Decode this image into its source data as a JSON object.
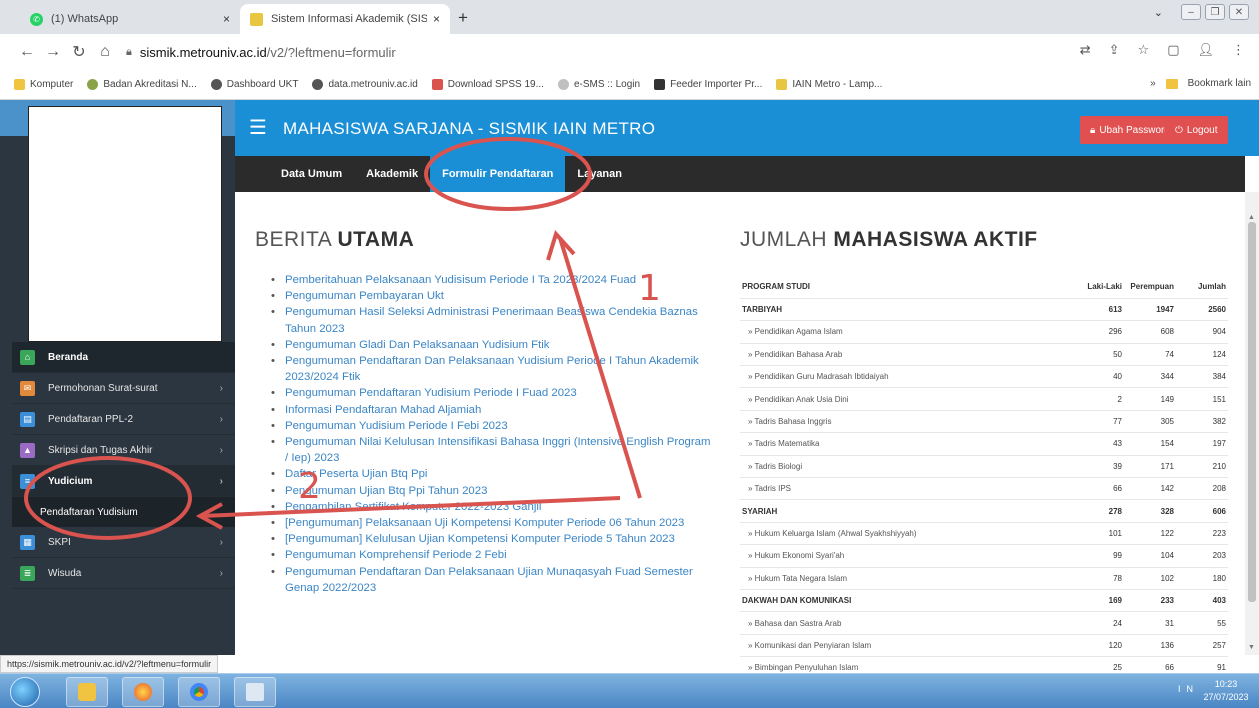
{
  "browser": {
    "tabs": [
      {
        "title": "(1) WhatsApp",
        "close": "×"
      },
      {
        "title": "Sistem Informasi Akademik (SIS",
        "close": "×"
      }
    ],
    "new_tab": "+",
    "url_host": "sismik.metrouniv.ac.id",
    "url_path": "/v2/?leftmenu=formulir",
    "bookmarks": [
      {
        "label": "Komputer",
        "color": "#f0c341"
      },
      {
        "label": "Badan Akreditasi N...",
        "color": "#8aa34a"
      },
      {
        "label": "Dashboard UKT",
        "color": "#555555"
      },
      {
        "label": "data.metrouniv.ac.id",
        "color": "#555555"
      },
      {
        "label": "Download SPSS 19...",
        "color": "#d9534f"
      },
      {
        "label": "e-SMS :: Login",
        "color": "#c0c0c0"
      },
      {
        "label": "Feeder Importer Pr...",
        "color": "#333333"
      },
      {
        "label": "IAIN Metro - Lamp...",
        "color": "#e8c642"
      }
    ],
    "bookmarks_more": "»",
    "bookmark_right": "Bookmark lain",
    "status_url": "https://sismik.metrouniv.ac.id/v2/?leftmenu=formulir"
  },
  "topbar": {
    "title": "MAHASISWA SARJANA - SISMIK IAIN METRO",
    "change_password": "Ubah Password",
    "logout": "Logout"
  },
  "nav": [
    "Data Umum",
    "Akademik",
    "Formulir Pendaftaran",
    "Layanan"
  ],
  "sidebar": {
    "items": [
      {
        "label": "Beranda",
        "color": "#3aa65a",
        "arrow": ""
      },
      {
        "label": "Permohonan Surat-surat",
        "color": "#e2893c",
        "arrow": "›"
      },
      {
        "label": "Pendaftaran PPL-2",
        "color": "#3b8ed8",
        "arrow": "›"
      },
      {
        "label": "Skripsi dan Tugas Akhir",
        "color": "#9a6bc4",
        "arrow": "›"
      },
      {
        "label": "Yudicium",
        "color": "#3b8ed8",
        "arrow": "›"
      }
    ],
    "sub_item": "Pendaftaran Yudisium",
    "items_after": [
      {
        "label": "SKPI",
        "color": "#3b8ed8",
        "arrow": "›"
      },
      {
        "label": "Wisuda",
        "color": "#3aa65a",
        "arrow": "›"
      }
    ]
  },
  "berita": {
    "title_light": "BERITA",
    "title_bold": "UTAMA",
    "items": [
      "Pemberitahuan Pelaksanaan Yudisisum Periode I Ta 2023/2024 Fuad",
      "Pengumuman Pembayaran Ukt",
      "Pengumuman Hasil Seleksi Administrasi Penerimaan Beasiswa Cendekia Baznas Tahun 2023",
      "Pengumuman Gladi Dan Pelaksanaan Yudisium Ftik",
      "Pengumuman Pendaftaran Dan Pelaksanaan Yudisium Periode I Tahun Akademik 2023/2024 Ftik",
      "Pengumuman Pendaftaran Yudisium Periode I Fuad 2023",
      "Informasi Pendaftaran Mahad Aljamiah",
      "Pengumuman Yudisium Periode I Febi 2023",
      "Pengumuman Nilai Kelulusan Intensifikasi Bahasa Inggri (Intensive English Program / Iep) 2023",
      "Daftar Peserta Ujian Btq Ppi",
      "Pengumuman Ujian Btq Ppi Tahun 2023",
      "Pengambilan Sertifikat Komputer 2022-2023 Ganjil",
      "[Pengumuman] Pelaksanaan Uji Kompetensi Komputer Periode 06 Tahun 2023",
      "[Pengumuman] Kelulusan Ujian Kompetensi Komputer Periode 5 Tahun 2023",
      "Pengumuman Komprehensif Periode 2 Febi",
      "Pengumuman Pendaftaran Dan Pelaksanaan Ujian Munaqasyah Fuad Semester Genap 2022/2023"
    ]
  },
  "jumlah": {
    "title_light": "JUMLAH",
    "title_bold": "MAHASISWA AKTIF",
    "headers": [
      "PROGRAM STUDI",
      "Laki-Laki",
      "Perempuan",
      "Jumlah"
    ],
    "rows": [
      {
        "kind": "fac",
        "name": "TARBIYAH",
        "l": "613",
        "p": "1947",
        "j": "2560"
      },
      {
        "kind": "sub",
        "name": "» Pendidikan Agama Islam",
        "l": "296",
        "p": "608",
        "j": "904"
      },
      {
        "kind": "sub",
        "name": "» Pendidikan Bahasa Arab",
        "l": "50",
        "p": "74",
        "j": "124"
      },
      {
        "kind": "sub",
        "name": "» Pendidikan Guru Madrasah Ibtidaiyah",
        "l": "40",
        "p": "344",
        "j": "384"
      },
      {
        "kind": "sub",
        "name": "» Pendidikan Anak Usia Dini",
        "l": "2",
        "p": "149",
        "j": "151"
      },
      {
        "kind": "sub",
        "name": "» Tadris Bahasa Inggris",
        "l": "77",
        "p": "305",
        "j": "382"
      },
      {
        "kind": "sub",
        "name": "» Tadris Matematika",
        "l": "43",
        "p": "154",
        "j": "197"
      },
      {
        "kind": "sub",
        "name": "» Tadris Biologi",
        "l": "39",
        "p": "171",
        "j": "210"
      },
      {
        "kind": "sub",
        "name": "» Tadris IPS",
        "l": "66",
        "p": "142",
        "j": "208"
      },
      {
        "kind": "fac",
        "name": "SYARIAH",
        "l": "278",
        "p": "328",
        "j": "606"
      },
      {
        "kind": "sub",
        "name": "» Hukum Keluarga Islam (Ahwal Syakhshiyyah)",
        "l": "101",
        "p": "122",
        "j": "223"
      },
      {
        "kind": "sub",
        "name": "» Hukum Ekonomi Syari'ah",
        "l": "99",
        "p": "104",
        "j": "203"
      },
      {
        "kind": "sub",
        "name": "» Hukum Tata Negara Islam",
        "l": "78",
        "p": "102",
        "j": "180"
      },
      {
        "kind": "fac",
        "name": "DAKWAH DAN KOMUNIKASI",
        "l": "169",
        "p": "233",
        "j": "403"
      },
      {
        "kind": "sub",
        "name": "» Bahasa dan Sastra Arab",
        "l": "24",
        "p": "31",
        "j": "55"
      },
      {
        "kind": "sub",
        "name": "» Komunikasi dan Penyiaran Islam",
        "l": "120",
        "p": "136",
        "j": "257"
      },
      {
        "kind": "sub",
        "name": "» Bimbingan Penyuluhan Islam",
        "l": "25",
        "p": "66",
        "j": "91"
      }
    ]
  },
  "annotations": {
    "num1": "1",
    "num2": "2",
    "color": "#d9534f"
  },
  "taskbar": {
    "clock_time": "10:23",
    "clock_date": "27/07/2023",
    "tray": "IN"
  }
}
